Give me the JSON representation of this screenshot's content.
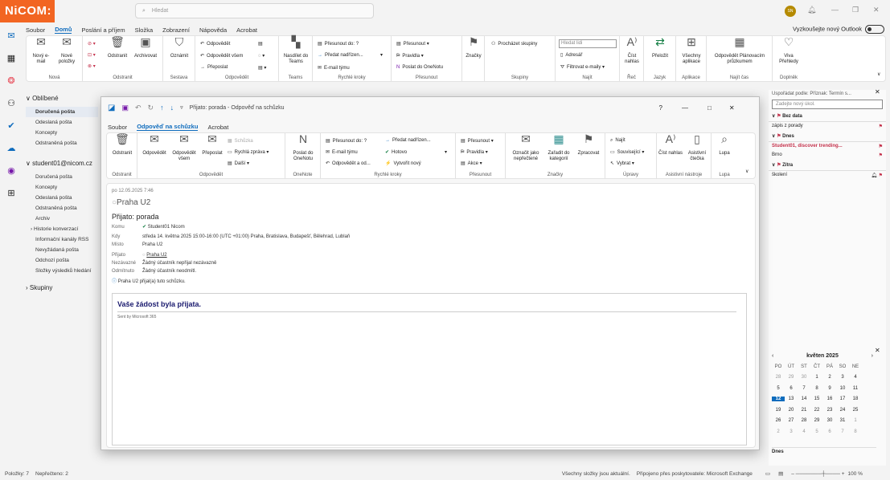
{
  "app": {
    "logo": "NiCOM:",
    "search_placeholder": "Hledat",
    "avatar": "SN",
    "new_outlook": "Vyzkoušejte nový Outlook"
  },
  "menu": [
    "Soubor",
    "Domů",
    "Poslání a příjem",
    "Složka",
    "Zobrazení",
    "Nápověda",
    "Acrobat"
  ],
  "ribbon": {
    "new_email": "Nový e-mail",
    "new_items": "Nové položky",
    "g_new": "Nová",
    "delete": "Odstranit",
    "archive": "Archivovat",
    "g_delete": "Odstranit",
    "report": "Oznámit",
    "g_report": "Sestava",
    "reply": "Odpovědět",
    "reply_all": "Odpovědět všem",
    "forward": "Přeposlat",
    "g_respond": "Odpovědět",
    "share_teams": "Nasdílet do Teams",
    "g_teams": "Teams",
    "qs_move": "Přesunout do: ?",
    "qs_manager": "Předat nadřízen...",
    "qs_team": "E-mail týmu",
    "g_quick": "Rychlé kroky",
    "move": "Přesunout",
    "rules": "Pravidla",
    "onenote": "Poslat do OneNotu",
    "g_move": "Přesunout",
    "tags": "Značky",
    "browse_groups": "Procházet skupiny",
    "g_groups": "Skupiny",
    "search_people": "Hledat lidi",
    "address_book": "Adresář",
    "filter_email": "Filtrovat e-maily",
    "g_find": "Najít",
    "read_aloud": "Číst nahlas",
    "g_speech": "Řeč",
    "translate": "Přeložit",
    "g_lang": "Jazyk",
    "all_apps": "Všechny aplikace",
    "g_apps": "Aplikace",
    "reply_poll": "Odpovědět Plánovacím průzkumem",
    "g_time": "Najít čas",
    "viva": "Viva Přehledy",
    "g_addin": "Doplněk"
  },
  "folders": {
    "favorites": "Oblíbené",
    "fav_items": [
      "Doručená pošta",
      "Odeslaná pošta",
      "Koncepty",
      "Odstraněná pošta"
    ],
    "account": "student01@nicom.cz",
    "acc_items": [
      "Doručená pošta",
      "Koncepty",
      "Odeslaná pošta",
      "Odstraněná pošta",
      "Archiv",
      "Historie konverzací",
      "Informační kanály RSS",
      "Nevyžádaná pošta",
      "Odchozí pošta",
      "Složky výsledků hledání"
    ],
    "groups": "Skupiny"
  },
  "todo": {
    "arrange": "Uspořádat podle: Příznak: Termín s...",
    "new_task": "Zadejte nový úkol.",
    "no_date": "Bez data",
    "no_date_items": [
      "zápis z porady"
    ],
    "today": "Dnes",
    "today_items": [
      "Student01, discover trending...",
      "Brno"
    ],
    "later": "Zítra",
    "later_items": [
      "školení"
    ]
  },
  "calendar": {
    "month": "květen 2025",
    "days": [
      "PO",
      "ÚT",
      "ST",
      "ČT",
      "PÁ",
      "SO",
      "NE"
    ],
    "cells": [
      "28",
      "29",
      "30",
      "1",
      "2",
      "3",
      "4",
      "5",
      "6",
      "7",
      "8",
      "9",
      "10",
      "11",
      "12",
      "13",
      "14",
      "15",
      "16",
      "17",
      "18",
      "19",
      "20",
      "21",
      "22",
      "23",
      "24",
      "25",
      "26",
      "27",
      "28",
      "29",
      "30",
      "31",
      "1",
      "2",
      "3",
      "4",
      "5",
      "6",
      "7",
      "8"
    ],
    "today_label": "Dnes"
  },
  "status": {
    "items": "Položky: 7",
    "unread": "Nepřečteno: 2",
    "sync": "Všechny složky jsou aktuální.",
    "connection": "Připojeno přes poskytovatele: Microsoft Exchange",
    "zoom": "100 %"
  },
  "modal": {
    "title": "Přijato: porada - Odpověď na schůzku",
    "help": "?",
    "menu": [
      "Soubor",
      "Odpověď na schůzku",
      "Acrobat"
    ],
    "delete": "Odstranit",
    "g_delete": "Odstranit",
    "reply": "Odpovědět",
    "reply_all": "Odpovědět všem",
    "forward": "Přeposlat",
    "meeting": "Schůzka",
    "quick_reply": "Rychlá zpráva",
    "more": "Další",
    "g_respond": "Odpovědět",
    "onenote": "Poslat do OneNotu",
    "g_onenote": "OneNote",
    "qs_move": "Přesunout do: ?",
    "qs_team": "E-mail týmu",
    "qs_reply_del": "Odpovědět a od...",
    "qs_manager": "Předat nadřízen...",
    "qs_done": "Hotovo",
    "qs_new": "Vytvořit nový",
    "g_quick": "Rychlé kroky",
    "move": "Přesunout",
    "rules": "Pravidla",
    "actions": "Akce",
    "g_move": "Přesunout",
    "mark_unread": "Označit jako nepřečtené",
    "categorize": "Zařadit do kategorií",
    "follow_up": "Zpracovat",
    "g_tags": "Značky",
    "find": "Najít",
    "related": "Související",
    "select": "Vybrat",
    "g_edit": "Úpravy",
    "read_aloud": "Číst nahlas",
    "immersive": "Asistivní čtečka",
    "g_assist": "Asistivní nástroje",
    "zoom": "Lupa",
    "g_zoom": "Lupa",
    "date": "po 12.05.2025 7:46",
    "sender": "Praha U2",
    "subject": "Přijato: porada",
    "to_label": "Komu",
    "to_value": "Student01 Nicom",
    "when_label": "Kdy",
    "when_value": "středa 14. května 2025 15:00-16:00 (UTC +01:00) Praha, Bratislava, Budapešť, Bělehrad, Lublaň",
    "where_label": "Místo",
    "where_value": "Praha U2",
    "accepted_label": "Přijato",
    "accepted_value": "Praha U2",
    "tentative_label": "Nezávazné",
    "tentative_value": "Žádný účastník nepřijal nezávazně",
    "declined_label": "Odmítnuto",
    "declined_value": "Žádný účastník neodmítl.",
    "info": "Praha U2 přijal(a) tuto schůzku.",
    "body_heading": "Vaše žádost byla přijata.",
    "body_sent": "Sent by Microsoft 365"
  }
}
